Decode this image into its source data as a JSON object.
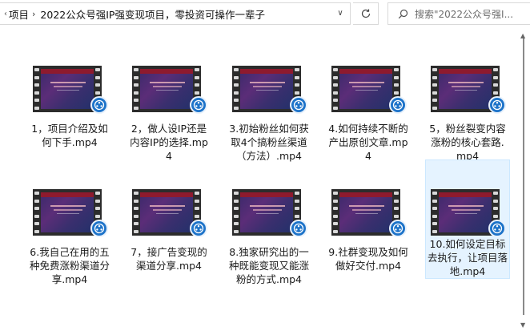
{
  "address_bar": {
    "segments": [
      "项目",
      "2022公众号强IP强变现项目，零投资可操作一辈子"
    ],
    "dropdown_icon": "chevron-down-icon",
    "refresh_icon": "refresh-icon"
  },
  "search": {
    "placeholder": "搜索\"2022公众号强I..."
  },
  "files": [
    {
      "name": "1，项目介绍及如何下手.mp4",
      "selected": false
    },
    {
      "name": "2，做人设IP还是内容IP的选择.mp4",
      "selected": false
    },
    {
      "name": "3.初始粉丝如何获取4个搞粉丝渠道（方法）.mp4",
      "selected": false
    },
    {
      "name": "4.如何持续不断的产出原创文章.mp4",
      "selected": false
    },
    {
      "name": "5，粉丝裂变内容涨粉的核心套路.mp4",
      "selected": false
    },
    {
      "name": "6.我自己在用的五种免费涨粉渠道分享.mp4",
      "selected": false
    },
    {
      "name": "7，接广告变现的渠道分享.mp4",
      "selected": false
    },
    {
      "name": "8.独家研究出的一种既能变现又能涨粉的方式.mp4",
      "selected": false
    },
    {
      "name": "9.社群变现及如何做好交付.mp4",
      "selected": false
    },
    {
      "name": "10.如何设定目标去执行，让项目落地.mp4",
      "selected": true
    }
  ],
  "colors": {
    "badge": "#1d73c9",
    "selection": "#e5f3ff"
  }
}
